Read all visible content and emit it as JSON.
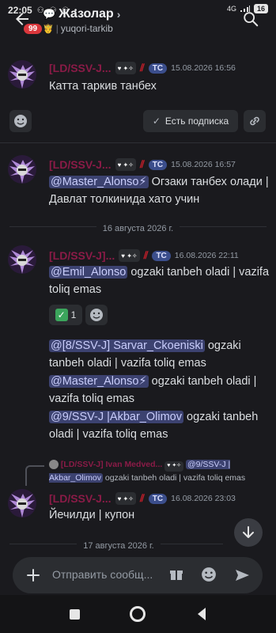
{
  "status": {
    "time": "22:05",
    "network": "4G",
    "battery": "16"
  },
  "header": {
    "title": "Жазолар",
    "subtitle": "yuqori-tarkib",
    "unread": "99"
  },
  "messages": [
    {
      "user": "[LD/SSV-J...",
      "time": "15.08.2026 16:56",
      "tc": "TC",
      "text": "Катта таркив танбех"
    },
    {
      "user": "[LD/SSV-J...",
      "time": "15.08.2026 16:57",
      "tc": "TC",
      "mention": "@Master_Alonso⚡",
      "text": "Огзаки танбех олади | Давлат толкинида хато учин"
    },
    {
      "user": "[LD/SSV-J]...",
      "time": "16.08.2026 22:11",
      "tc": "TC",
      "mention": "@Emil_Alonso",
      "text": "ogzaki tanbeh oladi | vazifa toliq emas",
      "reaction_count": "1",
      "followups": [
        {
          "mention": "@[8/SSV-J] Sarvar_Ckoeniski",
          "text": "ogzaki tanbeh oladi | vazifa toliq emas"
        },
        {
          "mention": "@Master_Alonso⚡",
          "text": "ogzaki tanbeh oladi | vazifa toliq emas"
        },
        {
          "mention": "@9/SSV-J |Akbar_Olimov",
          "text": "ogzaki tanbeh oladi | vazifa toliq emas"
        }
      ]
    },
    {
      "reply_user": "[LD/SSV-J] Ivan Medved...",
      "reply_mention": "@9/SSV-J | Akbar_Olimov",
      "reply_text": "ogzaki tanbeh oladi | vazifa toliq emas",
      "user": "[LD/SSV-J...",
      "time": "16.08.2026 23:03",
      "tc": "TC",
      "text": "Йечилди | купон"
    }
  ],
  "subscription": {
    "label": "Есть подписка"
  },
  "dates": {
    "first": "16 августа 2026 г.",
    "second": "17 августа 2026 г."
  },
  "composer": {
    "placeholder": "Отправить сообщ..."
  },
  "colors": {
    "username": "#8a1b47",
    "mention_bg": "#3c4270",
    "accent": "#5865f2"
  }
}
